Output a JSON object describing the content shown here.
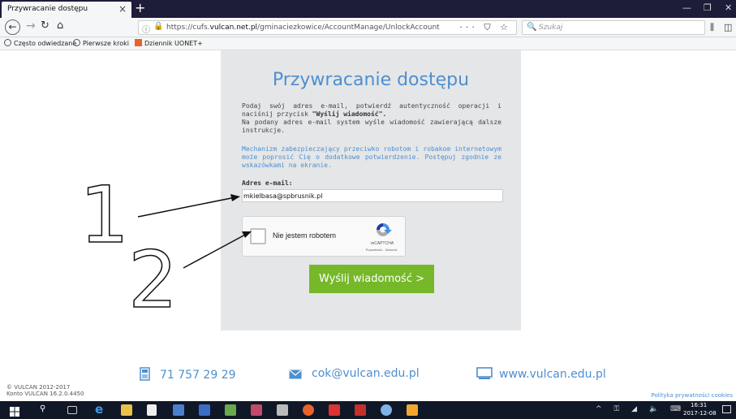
{
  "browser": {
    "tab_title": "Przywracanie dostępu",
    "tab_close": "×",
    "new_tab": "+",
    "url_prefix": "https://cufs.",
    "url_domain": "vulcan.net.pl",
    "url_path": "/gminaciezkowice/AccountManage/UnlockAccount",
    "url_actions": "··· ⛉ ☆",
    "search_placeholder": "Szukaj",
    "bookmarks": [
      {
        "label": "Często odwiedzane",
        "icon": "gear-icon",
        "color": "#555555"
      },
      {
        "label": "Pierwsze kroki",
        "icon": "firefox-icon",
        "color": "#555555"
      },
      {
        "label": "Dziennik UONET+",
        "icon": "uonet-icon",
        "color": "#e8632b"
      }
    ]
  },
  "page": {
    "title": "Przywracanie dostępu",
    "intro_1": "Podaj swój adres e-mail, potwierdź autentyczność operacji i naciśnij przycisk ",
    "intro_bold": "\"Wyślij wiadomość\".",
    "intro_2": "Na podany adres e-mail system wyśle wiadomość zawierającą dalsze instrukcje.",
    "captcha_note": "Mechanizm zabezpieczający przeciwko robotom i robakom internetowym może poprosić Cię o dodatkowe potwierdzenie. Postępuj zgodnie ze wskazówkami na ekranie.",
    "email_label": "Adres e-mail:",
    "email_value": "mkielbasa@spbrusnik.pl",
    "recaptcha_label": "Nie jestem robotem",
    "recaptcha_brand": "reCAPTCHA",
    "recaptcha_links": "Prywatność - Warunki",
    "send_button": "Wyślij wiadomość >",
    "annotation_1": "1",
    "annotation_2": "2"
  },
  "footer": {
    "phone": "71 757 29 29",
    "email": "cok@vulcan.edu.pl",
    "website": "www.vulcan.edu.pl",
    "copyright_1": "© VULCAN 2012-2017",
    "copyright_2": "Konto VULCAN 16.2.0.4450",
    "privacy": "Polityka prywatności cookies"
  },
  "taskbar": {
    "time": "16:31",
    "date": "2017-12-08",
    "tray": "^ ⚿ ◢ 🔈 ⌨"
  },
  "colors": {
    "accent_blue": "#4d8fd0",
    "button_green": "#76b82a",
    "panel_gray": "#e5e6e7",
    "tab_bar": "#1d1d3a"
  }
}
